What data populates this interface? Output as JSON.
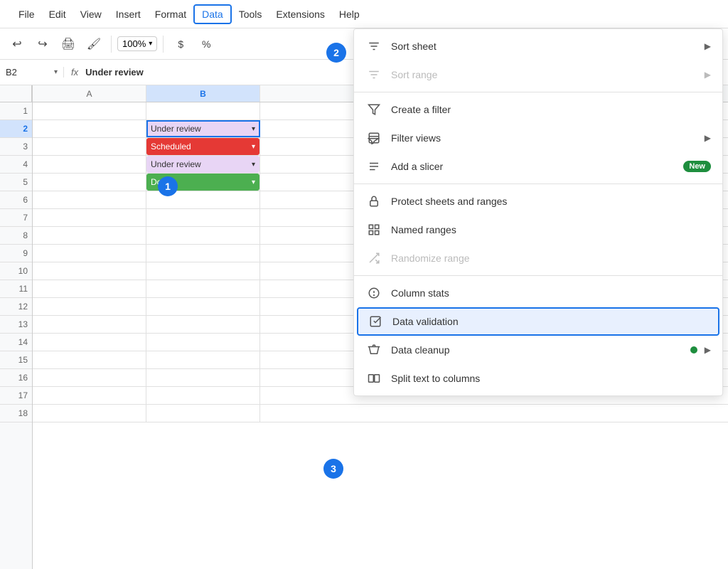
{
  "menubar": {
    "items": [
      {
        "label": "File",
        "active": false
      },
      {
        "label": "Edit",
        "active": false
      },
      {
        "label": "View",
        "active": false
      },
      {
        "label": "Insert",
        "active": false
      },
      {
        "label": "Format",
        "active": false
      },
      {
        "label": "Data",
        "active": true
      },
      {
        "label": "Tools",
        "active": false
      },
      {
        "label": "Extensions",
        "active": false
      },
      {
        "label": "Help",
        "active": false
      }
    ]
  },
  "toolbar": {
    "zoom": "100%",
    "currency_symbol": "$"
  },
  "formula_bar": {
    "cell_ref": "B2",
    "formula_value": "Under review"
  },
  "columns": [
    "A",
    "B"
  ],
  "rows": [
    {
      "num": 1,
      "A": "",
      "B": "",
      "B_type": ""
    },
    {
      "num": 2,
      "A": "",
      "B": "Under review",
      "B_type": "under-review"
    },
    {
      "num": 3,
      "A": "",
      "B": "Scheduled",
      "B_type": "scheduled"
    },
    {
      "num": 4,
      "A": "",
      "B": "Under review",
      "B_type": "under-review"
    },
    {
      "num": 5,
      "A": "",
      "B": "Done",
      "B_type": "done"
    },
    {
      "num": 6,
      "A": "",
      "B": "",
      "B_type": ""
    },
    {
      "num": 7,
      "A": "",
      "B": "",
      "B_type": ""
    },
    {
      "num": 8,
      "A": "",
      "B": "",
      "B_type": ""
    },
    {
      "num": 9,
      "A": "",
      "B": "",
      "B_type": ""
    },
    {
      "num": 10,
      "A": "",
      "B": "",
      "B_type": ""
    },
    {
      "num": 11,
      "A": "",
      "B": "",
      "B_type": ""
    },
    {
      "num": 12,
      "A": "",
      "B": "",
      "B_type": ""
    },
    {
      "num": 13,
      "A": "",
      "B": "",
      "B_type": ""
    },
    {
      "num": 14,
      "A": "",
      "B": "",
      "B_type": ""
    },
    {
      "num": 15,
      "A": "",
      "B": "",
      "B_type": ""
    },
    {
      "num": 16,
      "A": "",
      "B": "",
      "B_type": ""
    },
    {
      "num": 17,
      "A": "",
      "B": "",
      "B_type": ""
    },
    {
      "num": 18,
      "A": "",
      "B": "",
      "B_type": ""
    }
  ],
  "dropdown_menu": {
    "items": [
      {
        "id": "sort-sheet",
        "label": "Sort sheet",
        "icon": "sort",
        "has_arrow": true,
        "disabled": false,
        "badge": null,
        "highlighted": false
      },
      {
        "id": "sort-range",
        "label": "Sort range",
        "icon": "sort",
        "has_arrow": true,
        "disabled": true,
        "badge": null,
        "highlighted": false
      },
      {
        "id": "divider1"
      },
      {
        "id": "create-filter",
        "label": "Create a filter",
        "icon": "filter",
        "has_arrow": false,
        "disabled": false,
        "badge": null,
        "highlighted": false
      },
      {
        "id": "filter-views",
        "label": "Filter views",
        "icon": "filter-views",
        "has_arrow": true,
        "disabled": false,
        "badge": null,
        "highlighted": false
      },
      {
        "id": "add-slicer",
        "label": "Add a slicer",
        "icon": "slicer",
        "has_arrow": false,
        "disabled": false,
        "badge": "New",
        "highlighted": false
      },
      {
        "id": "divider2"
      },
      {
        "id": "protect-sheets",
        "label": "Protect sheets and ranges",
        "icon": "lock",
        "has_arrow": false,
        "disabled": false,
        "badge": null,
        "highlighted": false
      },
      {
        "id": "named-ranges",
        "label": "Named ranges",
        "icon": "named-ranges",
        "has_arrow": false,
        "disabled": false,
        "badge": null,
        "highlighted": false
      },
      {
        "id": "randomize",
        "label": "Randomize range",
        "icon": "randomize",
        "has_arrow": false,
        "disabled": true,
        "badge": null,
        "highlighted": false
      },
      {
        "id": "divider3"
      },
      {
        "id": "column-stats",
        "label": "Column stats",
        "icon": "stats",
        "has_arrow": false,
        "disabled": false,
        "badge": null,
        "highlighted": false
      },
      {
        "id": "data-validation",
        "label": "Data validation",
        "icon": "validation",
        "has_arrow": false,
        "disabled": false,
        "badge": null,
        "highlighted": true
      },
      {
        "id": "data-cleanup",
        "label": "Data cleanup",
        "icon": "cleanup",
        "has_arrow": true,
        "disabled": false,
        "badge": "dot",
        "highlighted": false
      },
      {
        "id": "split-text",
        "label": "Split text to columns",
        "icon": "split",
        "has_arrow": false,
        "disabled": false,
        "badge": null,
        "highlighted": false
      }
    ]
  },
  "annotations": {
    "badge1": "1",
    "badge2": "2",
    "badge3": "3"
  }
}
